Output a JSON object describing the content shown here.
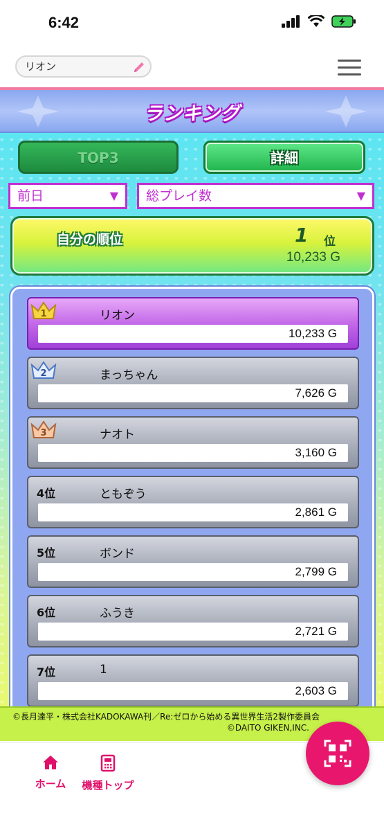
{
  "status_bar": {
    "time": "6:42"
  },
  "header": {
    "name_value": "リオン",
    "menu_icon": "hamburger-icon"
  },
  "page": {
    "title": "ランキング"
  },
  "tabs": [
    {
      "label": "TOP3",
      "active": false
    },
    {
      "label": "詳細",
      "active": true
    }
  ],
  "filters": {
    "period": "前日",
    "metric": "総プレイ数"
  },
  "my_rank": {
    "label": "自分の順位",
    "rank": "1",
    "rank_unit": "位",
    "value": "10,233 G"
  },
  "ranking": [
    {
      "rank": "1",
      "name": "リオン",
      "value": "10,233 G"
    },
    {
      "rank": "2",
      "name": "まっちゃん",
      "value": "7,626 G"
    },
    {
      "rank": "3",
      "name": "ナオト",
      "value": "3,160 G"
    },
    {
      "rank": "4位",
      "name": "ともぞう",
      "value": "2,861 G"
    },
    {
      "rank": "5位",
      "name": "ボンド",
      "value": "2,799 G"
    },
    {
      "rank": "6位",
      "name": "ふうき",
      "value": "2,721 G"
    },
    {
      "rank": "7位",
      "name": "1",
      "value": "2,603 G"
    }
  ],
  "copyright": {
    "line1": "©長月達平・株式会社KADOKAWA刊／Re:ゼロから始める異世界生活2製作委員会",
    "line2": "©DAITO GIKEN,INC."
  },
  "nav": {
    "home": "ホーム",
    "model_top": "機種トップ"
  },
  "colors": {
    "accent": "#e8176d",
    "purple": "#c12fd1",
    "green": "#1f7a3a"
  }
}
